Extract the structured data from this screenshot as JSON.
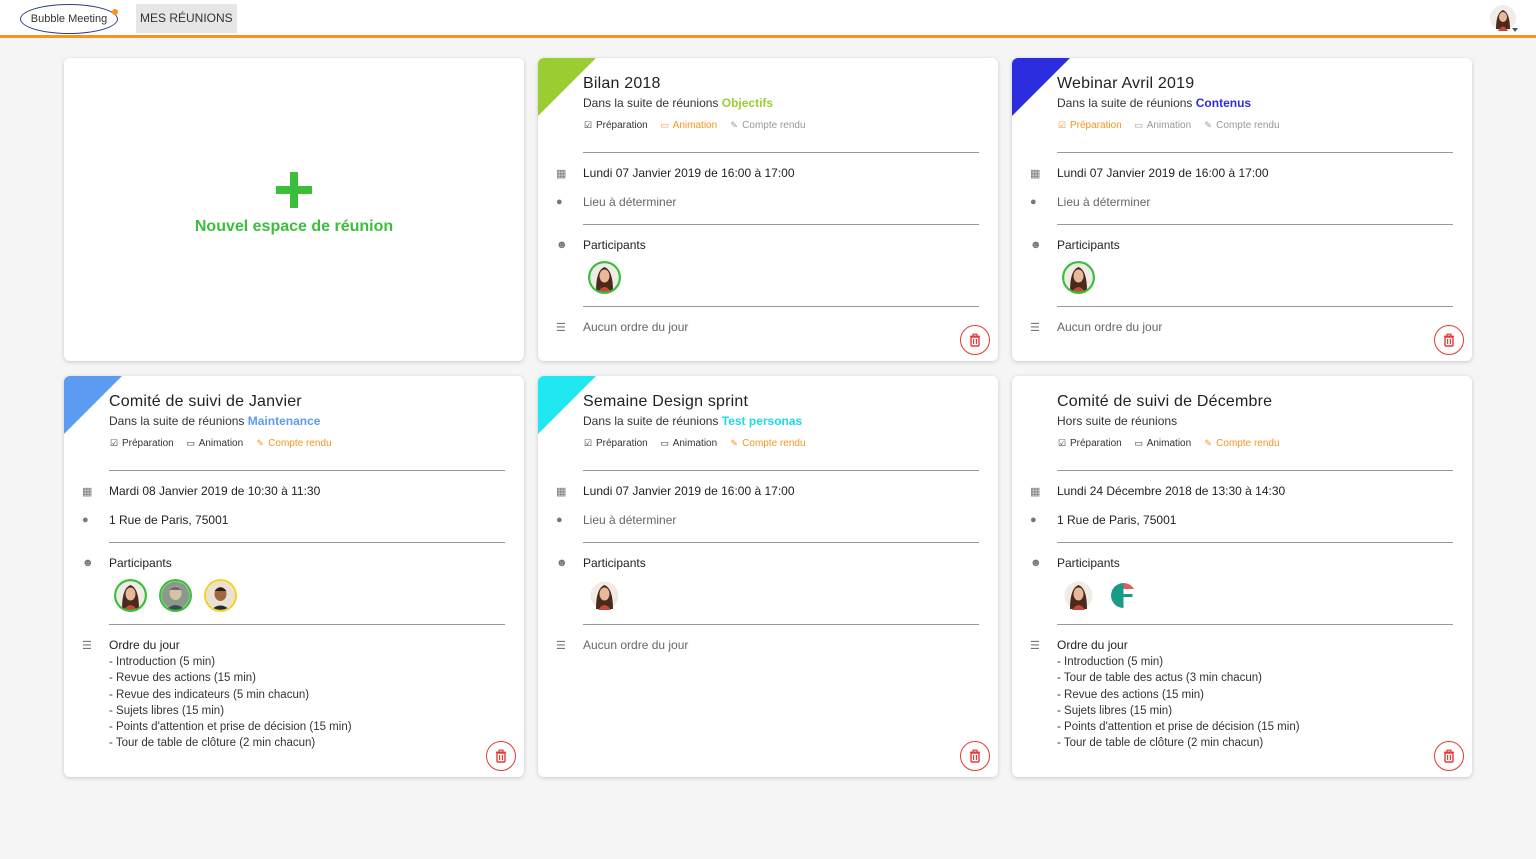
{
  "header": {
    "logo_text": "Bubble Meeting",
    "nav_tab": "MES RÉUNIONS",
    "accent_color": "#f7941d"
  },
  "new_card": {
    "label": "Nouvel espace de réunion",
    "color": "#3bbf3b"
  },
  "labels": {
    "participants": "Participants",
    "agenda_title": "Ordre du jour",
    "no_agenda": "Aucun ordre du jour",
    "prefix_suite": "Dans la suite de réunions "
  },
  "phases": {
    "prep": "Préparation",
    "anim": "Animation",
    "report": "Compte rendu"
  },
  "cards": [
    {
      "title": "Bilan 2018",
      "suite": "Objectifs",
      "suite_color": "#9acd32",
      "corner_color": "#9acd32",
      "phase_state": [
        "done",
        "active",
        "inactive"
      ],
      "date": "Lundi 07 Janvier 2019 de 16:00 à 17:00",
      "location": "Lieu à déterminer",
      "location_muted": true,
      "participants": [
        {
          "avatar": "woman",
          "ring": "#3bbf3b"
        }
      ],
      "agenda": []
    },
    {
      "title": "Webinar Avril 2019",
      "suite": "Contenus",
      "suite_color": "#2d2de0",
      "corner_color": "#2d2de0",
      "phase_state": [
        "active",
        "inactive",
        "inactive"
      ],
      "date": "Lundi 07 Janvier 2019 de 16:00 à 17:00",
      "location": "Lieu à déterminer",
      "location_muted": true,
      "participants": [
        {
          "avatar": "woman",
          "ring": "#3bbf3b"
        }
      ],
      "agenda": []
    },
    {
      "title": "Comité de suivi de Janvier",
      "suite": "Maintenance",
      "suite_color": "#5b9cf0",
      "corner_color": "#5b9cf0",
      "phase_state": [
        "done",
        "done",
        "active"
      ],
      "date": "Mardi 08 Janvier 2019 de 10:30 à 11:30",
      "location": "1 Rue de Paris, 75001",
      "location_muted": false,
      "participants": [
        {
          "avatar": "woman",
          "ring": "#3bbf3b"
        },
        {
          "avatar": "man-gray",
          "ring": "#3bbf3b"
        },
        {
          "avatar": "man-dark",
          "ring": "#f2d230"
        }
      ],
      "agenda": [
        "- Introduction (5 min)",
        "- Revue des actions (15 min)",
        "- Revue des indicateurs (5 min chacun)",
        "- Sujets libres (15 min)",
        "- Points d'attention et prise de décision (15 min)",
        "- Tour de table de clôture (2 min chacun)"
      ]
    },
    {
      "title": "Semaine Design sprint",
      "suite": "Test personas",
      "suite_color": "#1fd8e8",
      "corner_color": "#1fe8f0",
      "phase_state": [
        "done",
        "done",
        "active"
      ],
      "date": "Lundi 07 Janvier 2019 de 16:00 à 17:00",
      "location": "Lieu à déterminer",
      "location_muted": true,
      "participants": [
        {
          "avatar": "woman",
          "ring": ""
        }
      ],
      "agenda": []
    },
    {
      "title": "Comité de suivi de Décembre",
      "subtitle_plain": "Hors suite de réunions",
      "corner_color": "",
      "phase_state": [
        "done",
        "done",
        "active"
      ],
      "date": "Lundi 24 Décembre 2018 de 13:30 à 14:30",
      "location": "1 Rue de Paris, 75001",
      "location_muted": false,
      "participants": [
        {
          "avatar": "woman",
          "ring": ""
        },
        {
          "avatar": "logo-teal",
          "ring": ""
        }
      ],
      "agenda": [
        "- Introduction (5 min)",
        "- Tour de table des actus (3 min chacun)",
        "- Revue des actions (15 min)",
        "- Sujets libres (15 min)",
        "- Points d'attention et prise de décision (15 min)",
        "- Tour de table de clôture (2 min chacun)"
      ]
    }
  ]
}
